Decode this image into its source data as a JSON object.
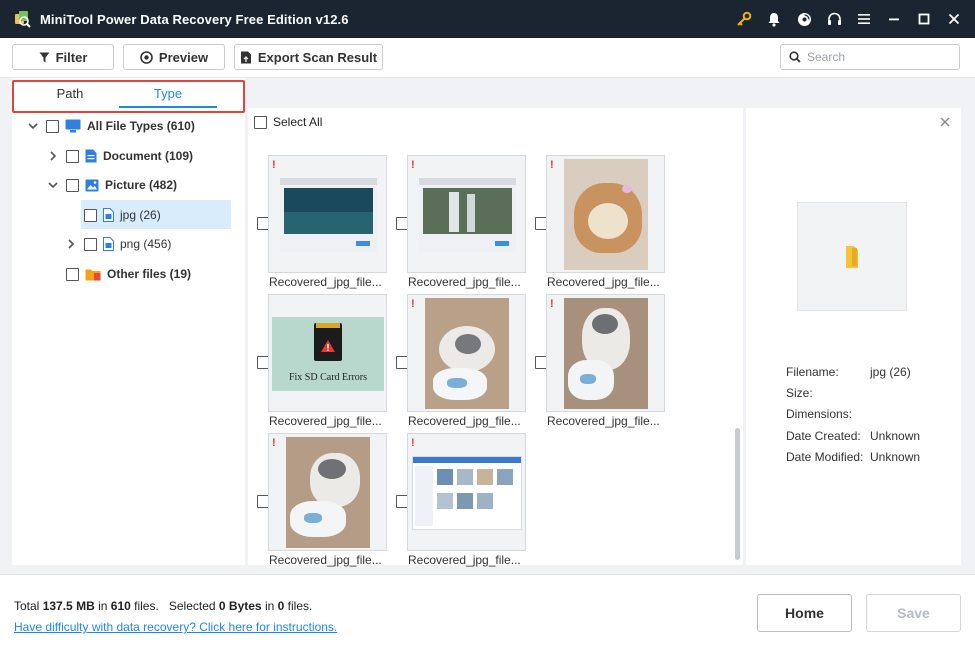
{
  "window": {
    "title": "MiniTool Power Data Recovery Free Edition v12.6"
  },
  "toolbar": {
    "filter_label": "Filter",
    "preview_label": "Preview",
    "export_label": "Export Scan Result",
    "search_placeholder": "Search",
    "search_value": ""
  },
  "tabs": {
    "path_label": "Path",
    "type_label": "Type",
    "active": "Type"
  },
  "tree": {
    "all": "All File Types (610)",
    "document": "Document (109)",
    "picture": "Picture (482)",
    "jpg": "jpg (26)",
    "png": "png (456)",
    "other": "Other files (19)"
  },
  "grid": {
    "select_all": "Select All",
    "items": [
      {
        "label": "Recovered_jpg_file...",
        "kind": "screenshot-water"
      },
      {
        "label": "Recovered_jpg_file...",
        "kind": "screenshot-waterfall"
      },
      {
        "label": "Recovered_jpg_file...",
        "kind": "cat-orange"
      },
      {
        "label": "Recovered_jpg_file...",
        "kind": "sd-card",
        "caption": "Fix SD Card Errors"
      },
      {
        "label": "Recovered_jpg_file...",
        "kind": "cat-grey-slipper"
      },
      {
        "label": "Recovered_jpg_file...",
        "kind": "cat-grey-up"
      },
      {
        "label": "Recovered_jpg_file...",
        "kind": "cat-grey-slipper-2"
      },
      {
        "label": "Recovered_jpg_file...",
        "kind": "screenshot-app"
      }
    ]
  },
  "preview": {
    "filename_label": "Filename:",
    "filename_value": "jpg (26)",
    "size_label": "Size:",
    "size_value": "",
    "dimensions_label": "Dimensions:",
    "dimensions_value": "",
    "created_label": "Date Created:",
    "created_value": "Unknown",
    "modified_label": "Date Modified:",
    "modified_value": "Unknown"
  },
  "footer": {
    "total_prefix": "Total",
    "total_size": "137.5 MB",
    "in_word": "in",
    "total_files": "610",
    "files_word": "files.",
    "selected_prefix": "Selected",
    "selected_size": "0 Bytes",
    "selected_in": "in",
    "selected_files": "0",
    "selected_files_word": "files.",
    "help_link": "Have difficulty with data recovery? Click here for instructions.",
    "home_label": "Home",
    "save_label": "Save"
  },
  "colors": {
    "titlebar": "#1b2431",
    "accent": "#1e88e5",
    "highlight_border": "#e0443b",
    "key_icon": "#f5b800",
    "warn": "#e23a2e"
  }
}
